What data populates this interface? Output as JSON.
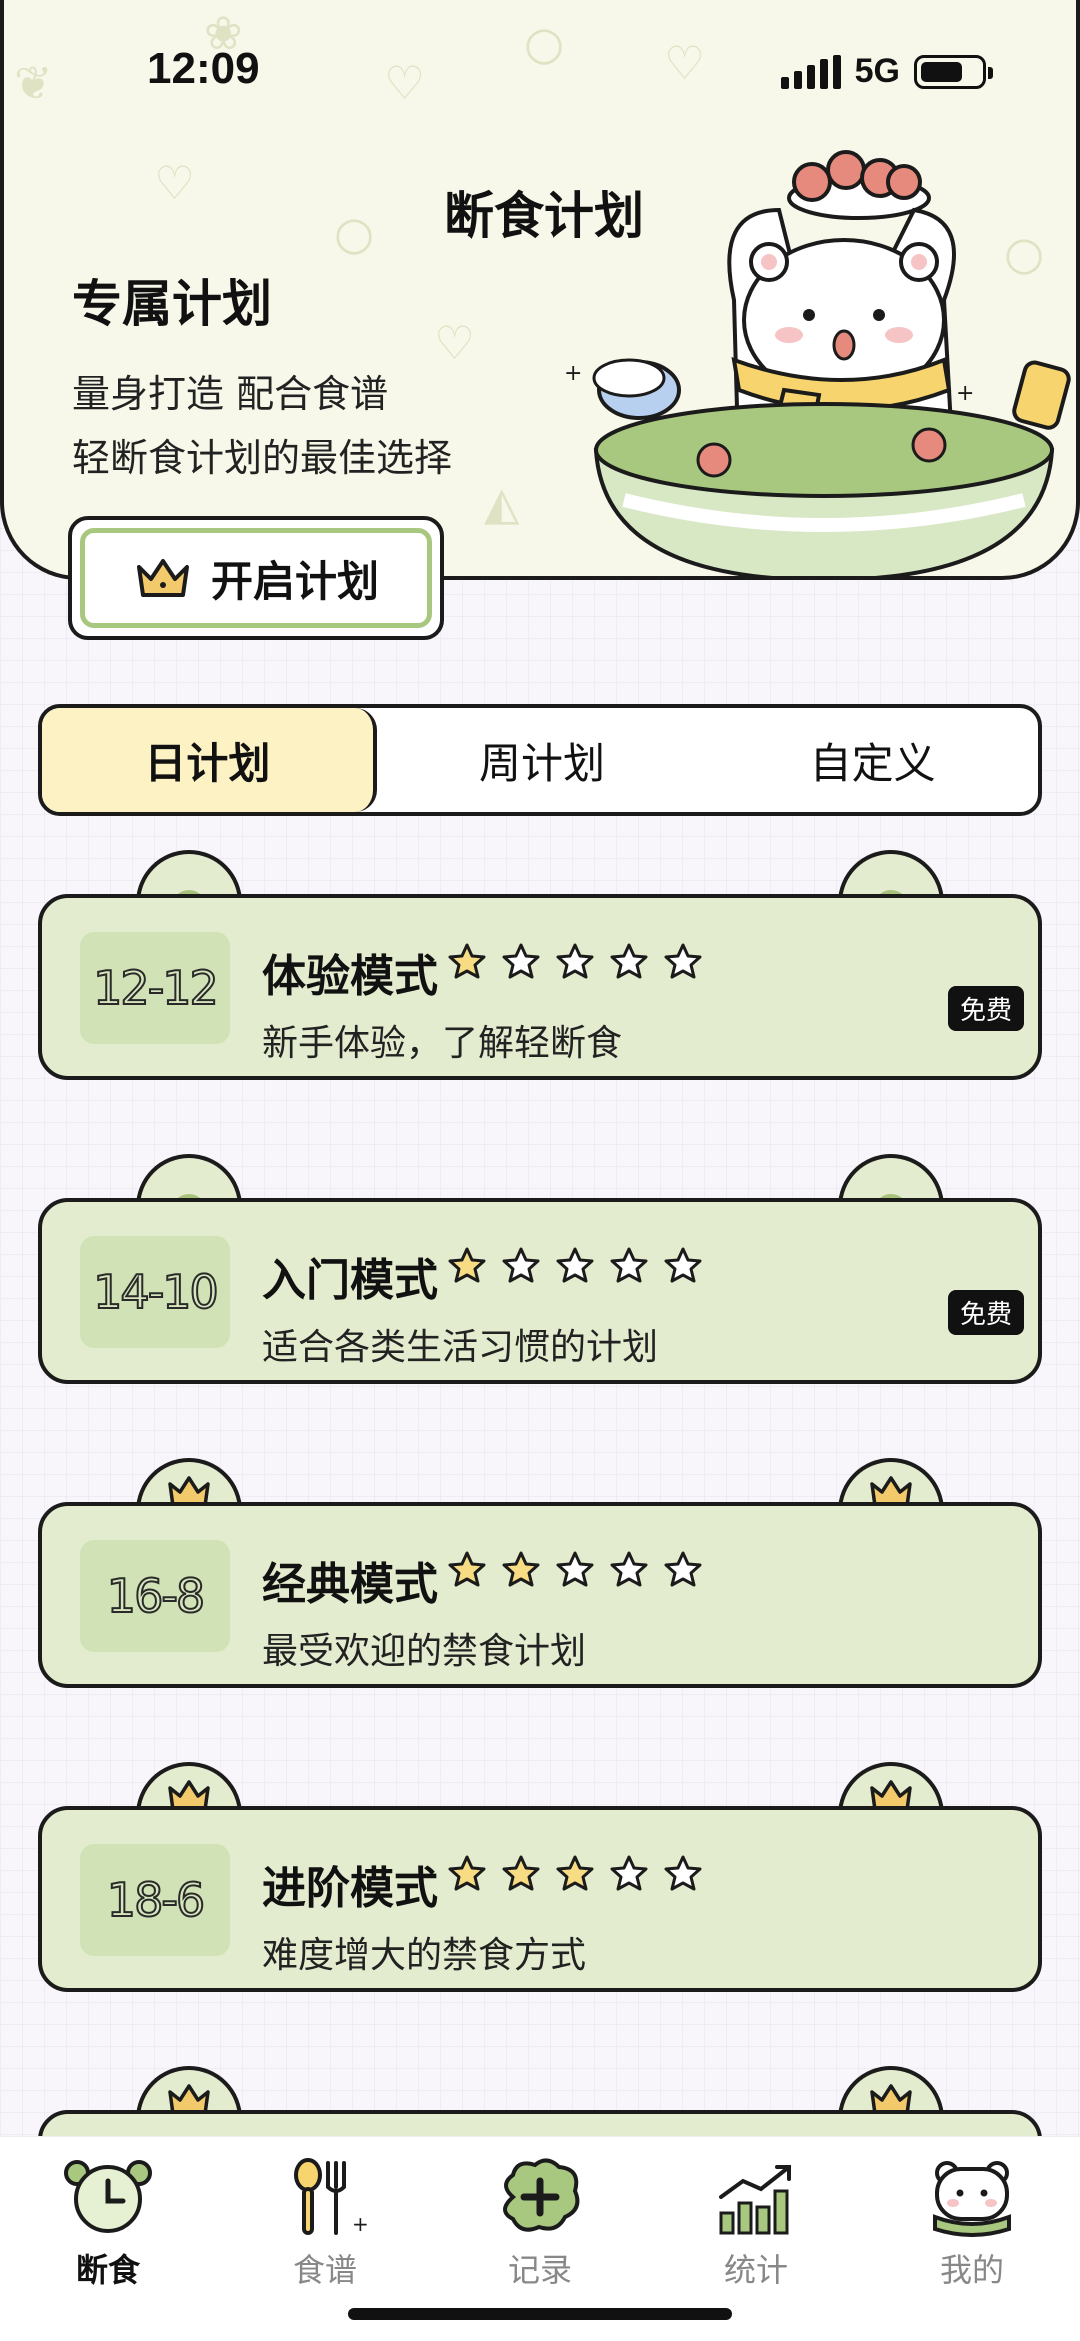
{
  "status": {
    "time": "12:09",
    "network": "5G"
  },
  "header": {
    "hero_title": "断食计划",
    "plan_title": "专属计划",
    "plan_desc_line1": "量身打造 配合食谱",
    "plan_desc_line2": "轻断食计划的最佳选择",
    "start_button": "开启计划"
  },
  "tabs": [
    {
      "label": "日计划",
      "active": true
    },
    {
      "label": "周计划",
      "active": false
    },
    {
      "label": "自定义",
      "active": false
    }
  ],
  "plans": [
    {
      "ratio": "12-12",
      "name": "体验模式",
      "stars": 1,
      "desc": "新手体验，了解轻断食",
      "badge": "免费",
      "locked": false
    },
    {
      "ratio": "14-10",
      "name": "入门模式",
      "stars": 1,
      "desc": "适合各类生活习惯的计划",
      "badge": "免费",
      "locked": false
    },
    {
      "ratio": "16-8",
      "name": "经典模式",
      "stars": 2,
      "desc": "最受欢迎的禁食计划",
      "badge": "",
      "locked": true
    },
    {
      "ratio": "18-6",
      "name": "进阶模式",
      "stars": 3,
      "desc": "难度增大的禁食方式",
      "badge": "",
      "locked": true
    }
  ],
  "nav": [
    {
      "label": "断食",
      "icon": "alarm-clock-icon",
      "active": true
    },
    {
      "label": "食谱",
      "icon": "utensils-icon",
      "active": false
    },
    {
      "label": "记录",
      "icon": "add-record-icon",
      "active": false
    },
    {
      "label": "统计",
      "icon": "stats-chart-icon",
      "active": false
    },
    {
      "label": "我的",
      "icon": "bear-profile-icon",
      "active": false
    }
  ],
  "colors": {
    "card": "#e4eccf",
    "accent_green": "#a8c880",
    "tab_active": "#fcf2c4",
    "star_fill": "#f7dc84"
  }
}
